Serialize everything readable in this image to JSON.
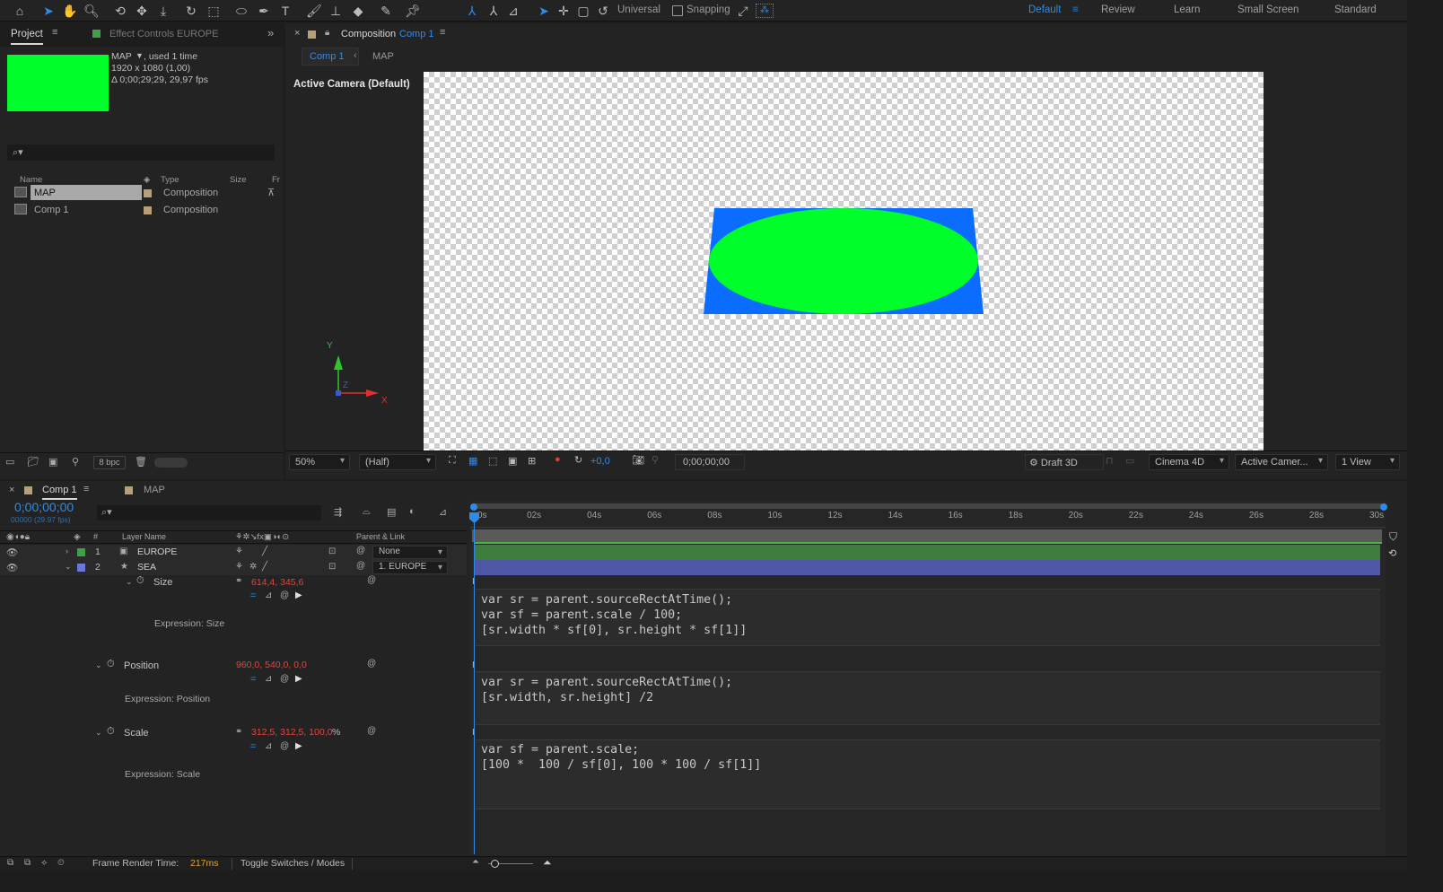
{
  "toolbar": {
    "tools": [
      "home-icon",
      "selection-icon",
      "hand-icon",
      "zoom-icon",
      "orbit-icon",
      "pan-icon",
      "dolly-icon",
      "rotate-icon",
      "region-icon",
      "ellipse-icon",
      "pen-icon",
      "type-icon",
      "brush-icon",
      "stamp-icon",
      "eraser-icon",
      "roto-icon",
      "pin-icon"
    ],
    "axis_mode_label": "Universal",
    "snapping_label": "Snapping",
    "workspaces": [
      "Default",
      "Review",
      "Learn",
      "Small Screen",
      "Standard"
    ],
    "active_workspace": "Default"
  },
  "project_panel": {
    "tab_label": "Project",
    "effect_controls_label": "Effect Controls EUROPE",
    "selected_item": {
      "name": "MAP",
      "usage": ", used 1 time",
      "resolution": "1920 x 1080 (1,00)",
      "duration": "Δ 0;00;29;29, 29,97 fps",
      "thumbnail_color": "#00ff2a"
    },
    "columns": [
      "Name",
      "Type",
      "Size",
      "Fr"
    ],
    "items": [
      {
        "name": "MAP",
        "type": "Composition",
        "label_color": "#b79f79"
      },
      {
        "name": "Comp 1",
        "type": "Composition",
        "label_color": "#b79f79"
      }
    ],
    "bpc_label": "8 bpc"
  },
  "comp_panel": {
    "tab_prefix": "Composition",
    "tab_name": "Comp 1",
    "breadcrumb": [
      "Comp 1",
      "MAP"
    ],
    "camera_label": "Active Camera (Default)",
    "axis_labels": {
      "y": "Y",
      "z": "Z",
      "x": "X"
    },
    "shapes": {
      "rect_color": "#0a6dff",
      "ellipse_color": "#00ff2a"
    }
  },
  "viewer_bar": {
    "zoom": "50%",
    "resolution": "(Half)",
    "exposure": "+0,0",
    "timecode": "0;00;00;00",
    "draft3d_label": "Draft 3D",
    "renderer": "Cinema 4D",
    "camera": "Active Camer...",
    "views": "1 View"
  },
  "timeline": {
    "tabs": [
      "Comp 1",
      "MAP"
    ],
    "timecode": "0;00;00;00",
    "frame_info": "00000 (29.97 fps)",
    "column_layer_name": "Layer Name",
    "column_parent": "Parent & Link",
    "column_num": "#",
    "ruler": [
      "0s",
      "02s",
      "04s",
      "06s",
      "08s",
      "10s",
      "12s",
      "14s",
      "16s",
      "18s",
      "20s",
      "22s",
      "24s",
      "26s",
      "28s",
      "30s"
    ],
    "layers": [
      {
        "num": "1",
        "name": "EUROPE",
        "color": "#3fa047",
        "parent": "None",
        "bar_color": "#3f7d3f"
      },
      {
        "num": "2",
        "name": "SEA",
        "color": "#6c78d8",
        "parent": "1. EUROPE",
        "bar_color": "#4d57a6"
      }
    ],
    "properties": [
      {
        "name": "Size",
        "value": "614,4, 345,6",
        "expr_label": "Expression: Size",
        "code": "var sr = parent.sourceRectAtTime();\nvar sf = parent.scale / 100;\n[sr.width * sf[0], sr.height * sf[1]]"
      },
      {
        "name": "Position",
        "value": "960,0, 540,0, 0,0",
        "expr_label": "Expression: Position",
        "code": "var sr = parent.sourceRectAtTime();\n[sr.width, sr.height] /2"
      },
      {
        "name": "Scale",
        "value": "312,5, 312,5, 100,0",
        "unit": "%",
        "expr_label": "Expression: Scale",
        "code": "var sf = parent.scale;\n[100 *  100 / sf[0], 100 * 100 / sf[1]]"
      }
    ]
  },
  "status": {
    "render_label": "Frame Render Time:",
    "render_time": "217ms",
    "toggle_label": "Toggle Switches / Modes"
  }
}
